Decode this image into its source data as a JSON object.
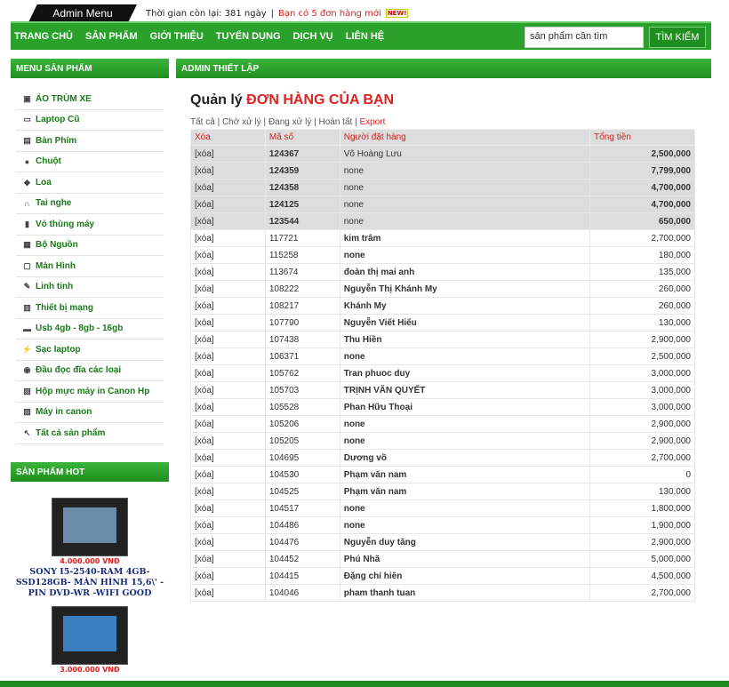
{
  "topbar": {
    "admin_menu": "Admin Menu",
    "time_left": "Thời gian còn lại: 381 ngày",
    "separator": "|",
    "orders_notice": "Bạn có 5 đơn hàng mới",
    "new_badge": "NEW!"
  },
  "nav": {
    "items": [
      "TRANG CHỦ",
      "SẢN PHẨM",
      "GIỚI THIỆU",
      "TUYỂN DỤNG",
      "DỊCH VỤ",
      "LIÊN HỆ"
    ],
    "search_placeholder": "sản phẩm cần tìm",
    "search_button": "TÌM KIẾM"
  },
  "sidebar": {
    "menu_title": "MENU SẢN PHẨM",
    "items": [
      {
        "label": "ÁO TRÙM XE",
        "icon": "jacket-icon"
      },
      {
        "label": "Laptop Cũ",
        "icon": "laptop-icon"
      },
      {
        "label": "Bàn Phím",
        "icon": "keyboard-icon"
      },
      {
        "label": "Chuột",
        "icon": "mouse-icon"
      },
      {
        "label": "Loa",
        "icon": "speaker-icon"
      },
      {
        "label": "Tai nghe",
        "icon": "headphone-icon"
      },
      {
        "label": "Vỏ thùng máy",
        "icon": "case-icon"
      },
      {
        "label": "Bộ Nguồn",
        "icon": "psu-icon"
      },
      {
        "label": "Màn Hình",
        "icon": "monitor-icon"
      },
      {
        "label": "Linh tinh",
        "icon": "misc-icon"
      },
      {
        "label": "Thiết bị mạng",
        "icon": "network-icon"
      },
      {
        "label": "Usb 4gb - 8gb - 16gb",
        "icon": "usb-icon"
      },
      {
        "label": "Sạc laptop",
        "icon": "charger-icon"
      },
      {
        "label": "Đầu đọc đĩa các loại",
        "icon": "disk-reader-icon"
      },
      {
        "label": "Hộp mực máy in Canon Hp",
        "icon": "ink-icon"
      },
      {
        "label": "Máy in canon",
        "icon": "printer-icon"
      },
      {
        "label": "Tất cả sản phẩm",
        "icon": "cursor-icon"
      }
    ],
    "hot_title": "SẢN PHẨM HOT",
    "hot_products": [
      {
        "price": "4.000.000 VNĐ",
        "name": "SONY I5-2540-RAM 4GB-SSD128GB- MÀN HÌNH 15,6\\' - PIN DVD-WR -WIFI GOOD"
      },
      {
        "price": "3.000.000 VNĐ",
        "name": ""
      }
    ]
  },
  "main": {
    "section_title": "ADMIN THIẾT LẬP",
    "title_prefix": "Quản lý",
    "title_red": "ĐƠN HÀNG CỦA BẠN",
    "filters": [
      "Tất cả",
      "Chờ xử lý",
      "Đang xử lý",
      "Hoàn tất"
    ],
    "export": "Export",
    "columns": [
      "Xóa",
      "Mã số",
      "Người đặt hàng",
      "Tổng tiền"
    ],
    "rows": [
      [
        "[xóa]",
        "124367",
        "Võ Hoàng Lưu",
        "2,500,000",
        true
      ],
      [
        "[xóa]",
        "124359",
        "none",
        "7,799,000",
        true
      ],
      [
        "[xóa]",
        "124358",
        "none",
        "4,700,000",
        true
      ],
      [
        "[xóa]",
        "124125",
        "none",
        "4,700,000",
        true
      ],
      [
        "[xóa]",
        "123544",
        "none",
        "650,000",
        true
      ],
      [
        "[xóa]",
        "117721",
        "kim trâm",
        "2,700,000",
        false
      ],
      [
        "[xóa]",
        "115258",
        "none",
        "180,000",
        false
      ],
      [
        "[xóa]",
        "113674",
        "đoàn thị mai anh",
        "135,000",
        false
      ],
      [
        "[xóa]",
        "108222",
        "Nguyễn Thị Khánh My",
        "260,000",
        false
      ],
      [
        "[xóa]",
        "108217",
        "Khánh My",
        "260,000",
        false
      ],
      [
        "[xóa]",
        "107790",
        "Nguyễn Viết Hiếu",
        "130,000",
        false
      ],
      [
        "[xóa]",
        "107438",
        "Thu Hiền",
        "2,900,000",
        false
      ],
      [
        "[xóa]",
        "106371",
        "none",
        "2,500,000",
        false
      ],
      [
        "[xóa]",
        "105762",
        "Tran phuoc duy",
        "3,000,000",
        false
      ],
      [
        "[xóa]",
        "105703",
        "TRỊNH VĂN QUYẾT",
        "3,000,000",
        false
      ],
      [
        "[xóa]",
        "105528",
        "Phan Hữu Thoại",
        "3,000,000",
        false
      ],
      [
        "[xóa]",
        "105206",
        "none",
        "2,900,000",
        false
      ],
      [
        "[xóa]",
        "105205",
        "none",
        "2,900,000",
        false
      ],
      [
        "[xóa]",
        "104695",
        "Dương võ",
        "2,700,000",
        false
      ],
      [
        "[xóa]",
        "104530",
        "Phạm văn nam",
        "0",
        false
      ],
      [
        "[xóa]",
        "104525",
        "Phạm văn nam",
        "130,000",
        false
      ],
      [
        "[xóa]",
        "104517",
        "none",
        "1,800,000",
        false
      ],
      [
        "[xóa]",
        "104486",
        "none",
        "1,900,000",
        false
      ],
      [
        "[xóa]",
        "104476",
        "Nguyễn duy tăng",
        "2,900,000",
        false
      ],
      [
        "[xóa]",
        "104452",
        "Phú Nhã",
        "5,000,000",
        false
      ],
      [
        "[xóa]",
        "104415",
        "Đặng chí hiên",
        "4,500,000",
        false
      ],
      [
        "[xóa]",
        "104046",
        "pham thanh tuan",
        "2,700,000",
        false
      ]
    ]
  }
}
